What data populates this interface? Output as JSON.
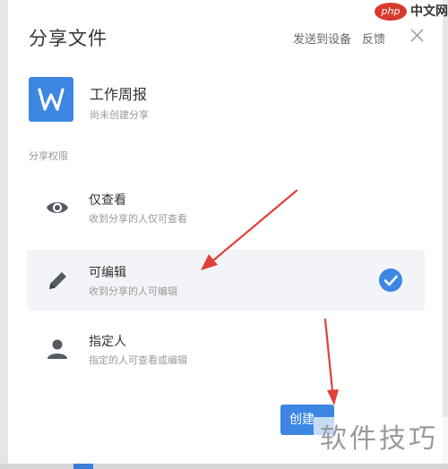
{
  "dialog": {
    "title": "分享文件",
    "send_to_device": "发送到设备",
    "feedback": "反馈",
    "close_icon": "close-icon"
  },
  "file": {
    "icon": "wps-writer-icon",
    "icon_letter": "W",
    "name": "工作周报",
    "status": "尚未创建分享"
  },
  "permissions": {
    "section_label": "分享权限",
    "options": [
      {
        "icon": "eye-icon",
        "title": "仅查看",
        "desc": "收到分享的人仅可查看",
        "selected": false
      },
      {
        "icon": "pencil-icon",
        "title": "可编辑",
        "desc": "收到分享的人可编辑",
        "selected": true
      },
      {
        "icon": "person-icon",
        "title": "指定人",
        "desc": "指定的人可查看或编辑",
        "selected": false
      }
    ]
  },
  "footer": {
    "create_label": "创建"
  },
  "watermarks": {
    "logo_php": "php",
    "logo_cn": "中文网",
    "bottom_text": "软件技巧"
  },
  "colors": {
    "accent": "#3d87e3",
    "annotation_arrow": "#e0403a",
    "selected_bg": "#f2f4f8"
  }
}
